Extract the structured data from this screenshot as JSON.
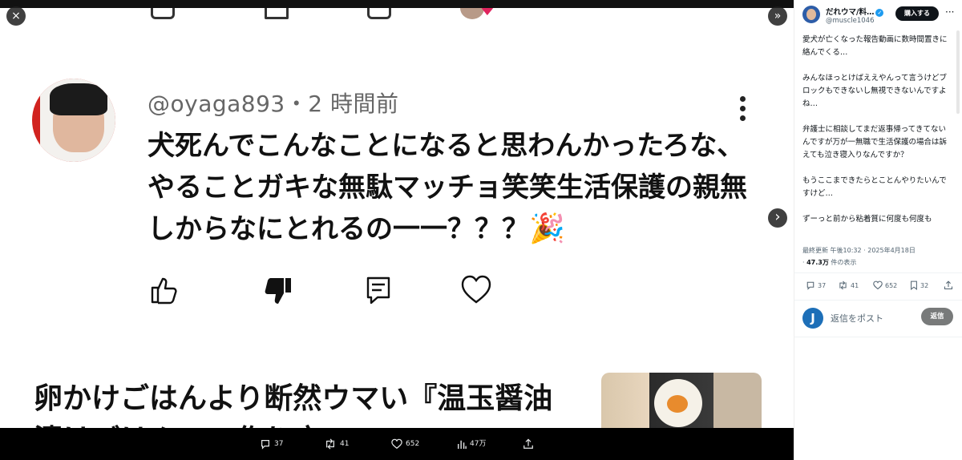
{
  "viewer": {
    "comment": {
      "handle": "@oyaga893",
      "separator": "・",
      "time": "2 時間前",
      "lines": [
        "犬死んでこんなことになると思わんかったろな、",
        "やることガキな無駄マッチョ笑笑生活保護の親無",
        "しからなにとれるの一一？？？"
      ],
      "emoji": "🎉"
    },
    "article": {
      "title_line1": "卵かけごはんより断然ウマい『温玉醤油",
      "title_line2": "漬けごはん』の作り方"
    },
    "bottom_bar": {
      "replies": "37",
      "reposts": "41",
      "likes": "652",
      "views": "47万"
    },
    "close_label": "×",
    "collapse_label": "»",
    "next_label": "›"
  },
  "panel": {
    "author_name": "だれウマ/料…",
    "author_handle": "@muscle1046",
    "subscribe_label": "購入する",
    "more_label": "···",
    "paragraphs": [
      "愛犬が亡くなった報告動画に数時間置きに絡んでくる…",
      "みんなほっとけばええやんって言うけどブロックもできないし無視できないんですよね…",
      "弁護士に相談してまだ返事帰ってきてないんですが万が一無職で生活保護の場合は訴えても泣き寝入りなんですか？",
      "もうここまできたらとことんやりたいんですけど…",
      "ずーっと前から粘着質に何度も何度も"
    ],
    "updated": "最終更新 午後10:32 · 2025年4月18日",
    "views_count": "47.3万",
    "views_suffix": " 件の表示",
    "views_prefix": "· ",
    "stats": {
      "replies": "37",
      "reposts": "41",
      "likes": "652",
      "bookmarks": "32"
    },
    "reply_avatar_letter": "J",
    "reply_placeholder": "返信をポスト",
    "reply_button": "返信"
  }
}
